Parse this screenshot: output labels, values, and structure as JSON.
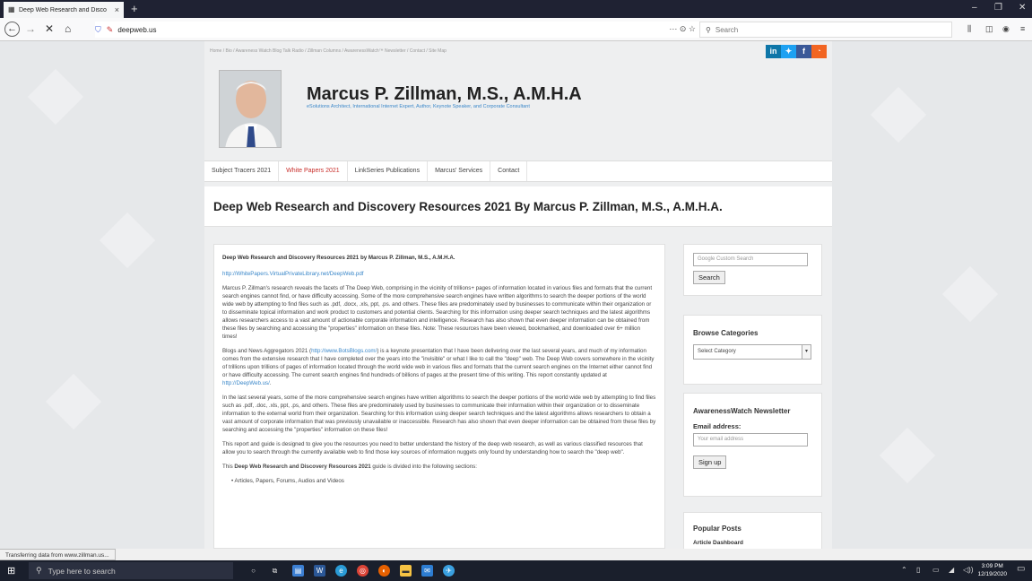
{
  "browser": {
    "tab_title": "Deep Web Research and Disco",
    "tab_close": "×",
    "new_tab": "+",
    "url": "deepweb.us",
    "page_actions": "··· ⊙ ☆",
    "search_placeholder": "Search",
    "window_controls": [
      "‒",
      "❐",
      "✕"
    ]
  },
  "site": {
    "breadcrumb": "Home / Bio / Awareness Watch Blog Talk Radio / Zillman Columns / AwarenessWatch™ Newsletter / Contact / Site Map",
    "social": [
      "in",
      "🐦",
      "f",
      "RSS"
    ],
    "name": "Marcus P. Zillman, M.S., A.M.H.A",
    "tagline": "eSolutions Architect, International Internet Expert, Author, Keynote Speaker, and Corporate Consultant",
    "menu": [
      "Subject Tracers 2021",
      "White Papers 2021",
      "LinkSeries Publications",
      "Marcus' Services",
      "Contact"
    ],
    "page_title": "Deep Web Research and Discovery Resources 2021 By Marcus P. Zillman, M.S., A.M.H.A."
  },
  "article": {
    "heading": "Deep Web Research and Discovery Resources 2021 by Marcus P. Zillman, M.S., A.M.H.A.",
    "pdf_link": "http://WhitePapers.VirtualPrivateLibrary.net/DeepWeb.pdf",
    "p1": "Marcus P. Zillman's research reveals the facets of The Deep Web, comprising in the vicinity of trillions+ pages of information located in various files and formats that the current search engines cannot find, or have difficulty accessing. Some of the more comprehensive search engines have written algorithms to search the deeper portions of the world wide web by attempting to find files such as .pdf, .docx, .xls, ppt, .ps. and others. These files are predominately used by businesses to communicate within their organization or to disseminate topical information and work product to customers and potential clients. Searching for this information using deeper search techniques and the latest algorithms allows researchers access to a vast amount of actionable corporate information and intelligence. Research has also shown that even deeper information can be obtained from these files by searching and accessing the \"properties\" information on these files.  Note: These resources have been viewed, bookmarked, and downloaded over 6+ million times!",
    "p2_a": "Blogs and News Aggregators 2021 (",
    "p2_link": "http://www.BotsBlogs.com/",
    "p2_b": ") is a keynote presentation that I have been delivering over the last several years, and much of my information comes from the extensive research that I have completed over the years into the \"invisible\" or what I like to call the \"deep\" web. The Deep Web covers somewhere in the vicinity of trillions upon trillions of pages of information located through the world wide web in various files and formats that the current search engines on the Internet either cannot find or have difficulty accessing. The current search engines find hundreds of billions of pages at the present time of this writing.  This report constantly updated at ",
    "p2_link2": "http://DeepWeb.us/",
    "p2_c": ".",
    "p3": "In the last several years, some of the more comprehensive search engines have written algorithms to search the deeper portions of the world wide web by attempting to find files such as .pdf, .doc, .xls, ppt, .ps, and others.  These files are predominately used by businesses to communicate their information within their organization or to disseminate information to the external world from their organization. Searching for this information using deeper search techniques and the latest algorithms allows researchers to obtain a vast amount of corporate information that was previously unavailable or inaccessible. Research has also shown that even deeper information can be obtained from these files by searching and accessing the \"properties\" information on these files!",
    "p4": "This report and guide is designed to give you the resources you need to better understand the history of the deep web research, as well as various classified resources that allow you to search through the currently available web to find those key sources of information nuggets only found by understanding how to search the \"deep web\".",
    "p5_a": "This ",
    "p5_bold": "Deep Web Research and Discovery Resources 2021",
    "p5_b": " guide is divided into the following sections:",
    "li1": "• Articles, Papers, Forums, Audios and Videos"
  },
  "sidebar": {
    "search_placeholder": "Google  Custom Search",
    "search_button": "Search",
    "browse_title": "Browse Categories",
    "select_value": "Select Category",
    "newsletter_title": "AwarenessWatch Newsletter",
    "email_label": "Email address:",
    "email_placeholder": "Your email address",
    "signup_button": "Sign up",
    "popular_title": "Popular Posts",
    "popular_item": "Article Dashboard"
  },
  "status_text": "Transferring data from www.zillman.us...",
  "taskbar": {
    "search_placeholder": "Type here to search",
    "time": "3:09 PM",
    "date": "12/19/2020"
  },
  "colors": {
    "linkedin": "#0e76a8",
    "twitter": "#1da1f2",
    "facebook": "#3b5998",
    "rss": "#f26522",
    "link": "#3a87c9",
    "active_menu": "#c9302c"
  }
}
